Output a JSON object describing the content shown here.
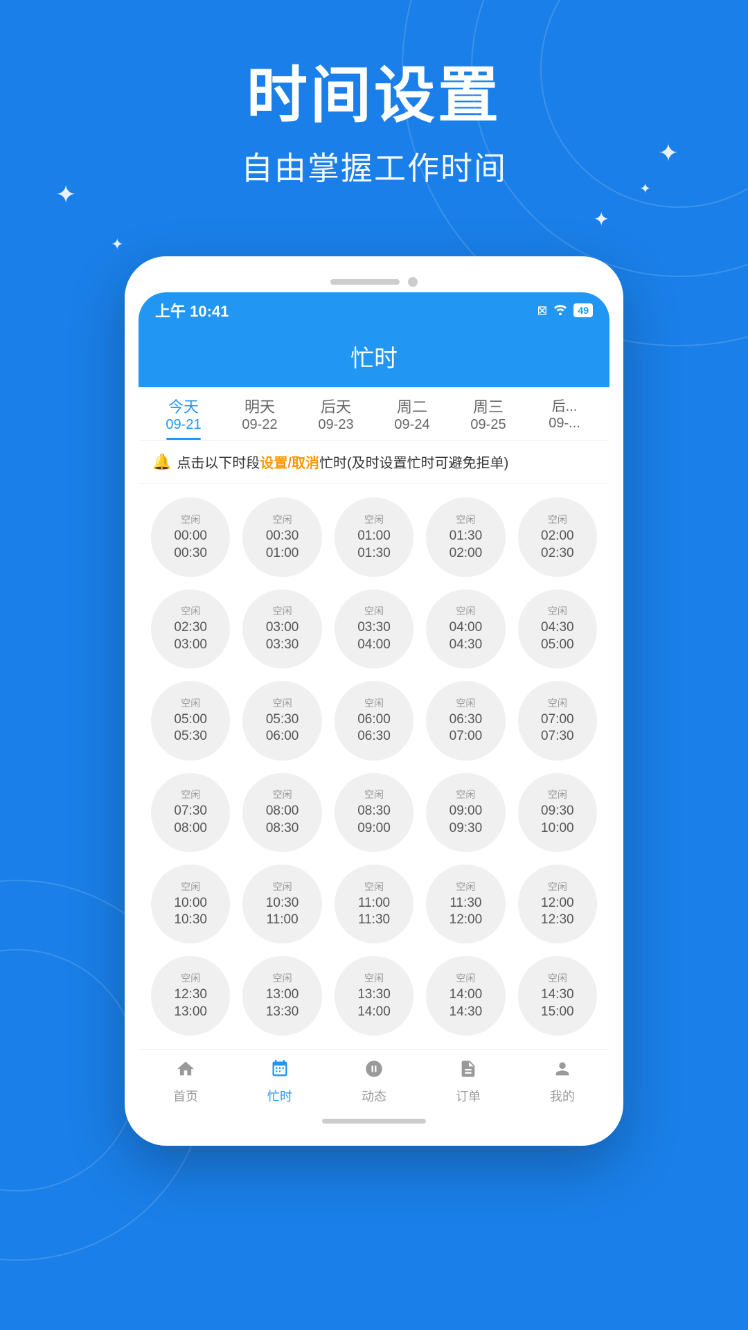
{
  "background_color": "#1a7fe8",
  "header": {
    "title": "时间设置",
    "subtitle": "自由掌握工作时间"
  },
  "sparkles": [
    "✦",
    "✦",
    "✦",
    "✦",
    "✦"
  ],
  "phone": {
    "status_bar": {
      "time": "上午 10:41",
      "icons": [
        "⊠",
        "WiFi",
        "49"
      ]
    },
    "app_title": "忙时",
    "tabs": [
      {
        "label": "今天",
        "date": "09-21",
        "active": true
      },
      {
        "label": "明天",
        "date": "09-22",
        "active": false
      },
      {
        "label": "后天",
        "date": "09-23",
        "active": false
      },
      {
        "label": "周二",
        "date": "09-24",
        "active": false
      },
      {
        "label": "周三",
        "date": "09-25",
        "active": false
      },
      {
        "label": "后...",
        "date": "09-...",
        "active": false
      }
    ],
    "notice": "点击以下时段设置/取消忙时(及时设置忙时可避免拒单)",
    "notice_highlight": "设置/取消",
    "time_slots": [
      {
        "label": "空闲",
        "start": "00:00",
        "end": "00:30"
      },
      {
        "label": "空闲",
        "start": "00:30",
        "end": "01:00"
      },
      {
        "label": "空闲",
        "start": "01:00",
        "end": "01:30"
      },
      {
        "label": "空闲",
        "start": "01:30",
        "end": "02:00"
      },
      {
        "label": "空闲",
        "start": "02:00",
        "end": "02:30"
      },
      {
        "label": "空闲",
        "start": "02:30",
        "end": "03:00"
      },
      {
        "label": "空闲",
        "start": "03:00",
        "end": "03:30"
      },
      {
        "label": "空闲",
        "start": "03:30",
        "end": "04:00"
      },
      {
        "label": "空闲",
        "start": "04:00",
        "end": "04:30"
      },
      {
        "label": "空闲",
        "start": "04:30",
        "end": "05:00"
      },
      {
        "label": "空闲",
        "start": "05:00",
        "end": "05:30"
      },
      {
        "label": "空闲",
        "start": "05:30",
        "end": "06:00"
      },
      {
        "label": "空闲",
        "start": "06:00",
        "end": "06:30"
      },
      {
        "label": "空闲",
        "start": "06:30",
        "end": "07:00"
      },
      {
        "label": "空闲",
        "start": "07:00",
        "end": "07:30"
      },
      {
        "label": "空闲",
        "start": "07:30",
        "end": "08:00"
      },
      {
        "label": "空闲",
        "start": "08:00",
        "end": "08:30"
      },
      {
        "label": "空闲",
        "start": "08:30",
        "end": "09:00"
      },
      {
        "label": "空闲",
        "start": "09:00",
        "end": "09:30"
      },
      {
        "label": "空闲",
        "start": "09:30",
        "end": "10:00"
      },
      {
        "label": "空闲",
        "start": "10:00",
        "end": "10:30"
      },
      {
        "label": "空闲",
        "start": "10:30",
        "end": "11:00"
      },
      {
        "label": "空闲",
        "start": "11:00",
        "end": "11:30"
      },
      {
        "label": "空闲",
        "start": "11:30",
        "end": "12:00"
      },
      {
        "label": "空闲",
        "start": "12:00",
        "end": "12:30"
      },
      {
        "label": "空闲",
        "start": "12:30",
        "end": "13:00"
      },
      {
        "label": "空闲",
        "start": "13:00",
        "end": "13:30"
      },
      {
        "label": "空闲",
        "start": "13:30",
        "end": "14:00"
      },
      {
        "label": "空闲",
        "start": "14:00",
        "end": "14:30"
      },
      {
        "label": "空闲",
        "start": "14:30",
        "end": "15:00"
      }
    ],
    "bottom_nav": [
      {
        "label": "首页",
        "icon": "🏠",
        "active": false
      },
      {
        "label": "忙时",
        "icon": "📅",
        "active": true
      },
      {
        "label": "动态",
        "icon": "🎯",
        "active": false
      },
      {
        "label": "订单",
        "icon": "📋",
        "active": false
      },
      {
        "label": "我的",
        "icon": "👤",
        "active": false
      }
    ]
  }
}
